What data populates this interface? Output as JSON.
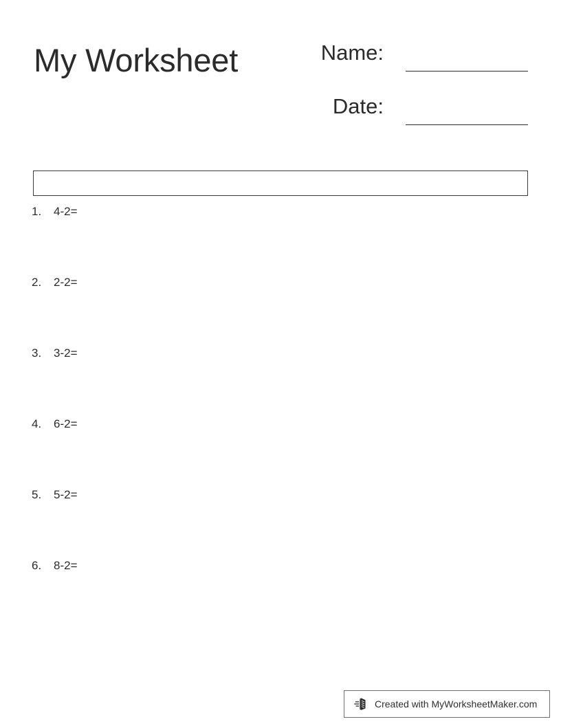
{
  "document": {
    "title": "My Worksheet",
    "page_background": "#ffffff",
    "text_color": "#2b2b2b"
  },
  "header": {
    "fields": [
      {
        "label": "Name:",
        "value": ""
      },
      {
        "label": "Date:",
        "value": ""
      }
    ]
  },
  "instructions": {
    "text": ""
  },
  "questions": [
    {
      "number": "1.",
      "expression": "4-2="
    },
    {
      "number": "2.",
      "expression": "2-2="
    },
    {
      "number": "3.",
      "expression": "3-2="
    },
    {
      "number": "4.",
      "expression": "6-2="
    },
    {
      "number": "5.",
      "expression": "5-2="
    },
    {
      "number": "6.",
      "expression": "8-2="
    }
  ],
  "footer": {
    "icon": "worksheet-maker-logo-icon",
    "text": "Created with MyWorksheetMaker.com",
    "border_color": "#6e6e6e"
  }
}
